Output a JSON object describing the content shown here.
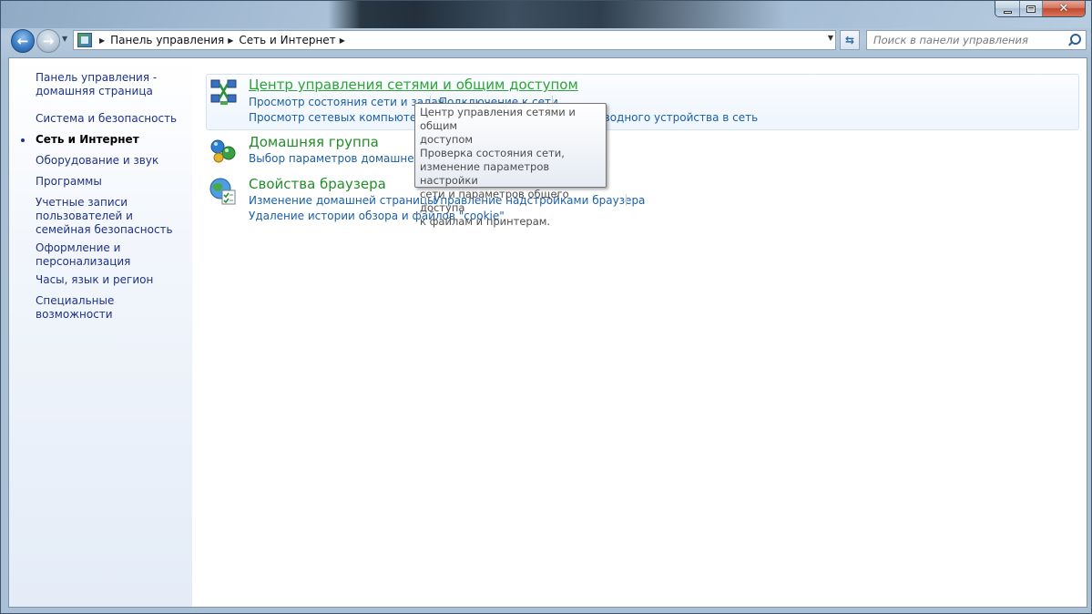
{
  "window": {
    "caption_buttons": {
      "minimize": "minimize-icon",
      "maximize": "maximize-icon",
      "close": "close-icon"
    }
  },
  "nav": {
    "breadcrumb": [
      "Панель управления",
      "Сеть и Интернет"
    ],
    "search_placeholder": "Поиск в панели управления"
  },
  "sidebar": {
    "items": [
      {
        "label": "Панель управления - домашняя страница",
        "active": false
      },
      {
        "label": "Система и безопасность",
        "active": false
      },
      {
        "label": "Сеть и Интернет",
        "active": true
      },
      {
        "label": "Оборудование и звук",
        "active": false
      },
      {
        "label": "Программы",
        "active": false
      },
      {
        "label": "Учетные записи пользователей и семейная безопасность",
        "active": false
      },
      {
        "label": "Оформление и персонализация",
        "active": false
      },
      {
        "label": "Часы, язык и регион",
        "active": false
      },
      {
        "label": "Специальные возможности",
        "active": false
      }
    ]
  },
  "categories": [
    {
      "title": "Центр управления сетями и общим доступом",
      "icon": "network-center-icon",
      "links": [
        "Просмотр состояния сети и задач",
        "Подключение к сети",
        "Просмотр сетевых компьютеров и устройств",
        "Добавление беспроводного устройства в сеть"
      ]
    },
    {
      "title": "Домашняя группа",
      "icon": "homegroup-icon",
      "links": [
        "Выбор параметров домашней группы и общего доступа"
      ]
    },
    {
      "title": "Свойства браузера",
      "icon": "internet-options-icon",
      "links": [
        "Изменение домашней страницы",
        "Управление надстройками браузера",
        "Удаление истории обзора и файлов \"cookie\""
      ]
    }
  ],
  "tooltip": {
    "lines": [
      "Центр управления сетями и общим",
      "доступом",
      "Проверка состояния сети,",
      "изменение параметров настройки",
      "сети и параметров общего доступа",
      "к файлам и принтерам."
    ]
  },
  "colors": {
    "link": "#1b5fa6",
    "category_title": "#248c2b",
    "sidebar_link": "#1e3287"
  }
}
